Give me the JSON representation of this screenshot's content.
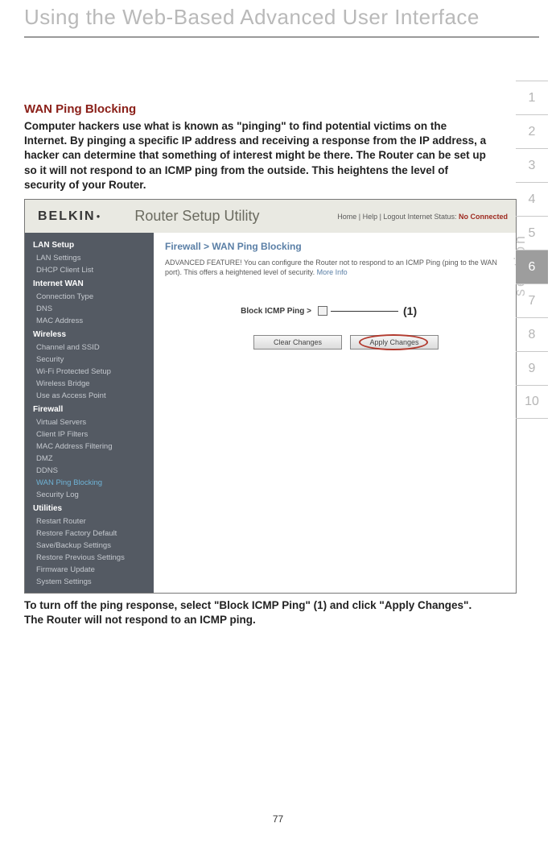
{
  "chapter_title": "Using the Web-Based Advanced User Interface",
  "heading": "WAN Ping Blocking",
  "paragraph1": "Computer hackers use what is known as \"pinging\" to find potential victims on the Internet. By pinging a specific IP address and receiving a response from the IP address, a hacker can determine that something of interest might be there. The Router can be set up so it will not respond to an ICMP ping from the outside. This heightens the level of security of your Router.",
  "paragraph2_a": "To turn off the ping response, select \"Block ICMP Ping\" ",
  "paragraph2_marker": "(1)",
  "paragraph2_b": " and click \"Apply Changes\". The Router will not respond to an ICMP ping.",
  "page_number": "77",
  "section_label": "section",
  "tabs": [
    "1",
    "2",
    "3",
    "4",
    "5",
    "6",
    "7",
    "8",
    "9",
    "10"
  ],
  "active_tab_index": 5,
  "screenshot": {
    "logo_text": "BELKIN",
    "utility_title": "Router Setup Utility",
    "top_links": "Home  |  Help |  Logout    Internet  Status: ",
    "top_status": "No Connected",
    "breadcrumb": "Firewall > WAN Ping Blocking",
    "adv_text_a": "ADVANCED FEATURE! You can configure the Router not to respond to an ICMP Ping (ping to the WAN port). This offers a heightened level of security. ",
    "adv_text_more": "More Info",
    "control_label": "Block ICMP Ping >",
    "callout": "(1)",
    "buttons": {
      "clear": "Clear Changes",
      "apply": "Apply Changes"
    },
    "sidebar": [
      {
        "type": "grp",
        "label": "LAN Setup"
      },
      {
        "type": "item",
        "label": "LAN Settings"
      },
      {
        "type": "item",
        "label": "DHCP Client List"
      },
      {
        "type": "grp",
        "label": "Internet WAN"
      },
      {
        "type": "item",
        "label": "Connection Type"
      },
      {
        "type": "item",
        "label": "DNS"
      },
      {
        "type": "item",
        "label": "MAC Address"
      },
      {
        "type": "grp",
        "label": "Wireless"
      },
      {
        "type": "item",
        "label": "Channel and SSID"
      },
      {
        "type": "item",
        "label": "Security"
      },
      {
        "type": "item",
        "label": "Wi-Fi Protected Setup"
      },
      {
        "type": "item",
        "label": "Wireless Bridge"
      },
      {
        "type": "item",
        "label": "Use as Access Point"
      },
      {
        "type": "grp",
        "label": "Firewall"
      },
      {
        "type": "item",
        "label": "Virtual Servers"
      },
      {
        "type": "item",
        "label": "Client IP Filters"
      },
      {
        "type": "item",
        "label": "MAC Address Filtering"
      },
      {
        "type": "item",
        "label": "DMZ"
      },
      {
        "type": "item",
        "label": "DDNS"
      },
      {
        "type": "item",
        "label": "WAN Ping Blocking",
        "active": true
      },
      {
        "type": "item",
        "label": "Security Log"
      },
      {
        "type": "grp",
        "label": "Utilities"
      },
      {
        "type": "item",
        "label": "Restart Router"
      },
      {
        "type": "item",
        "label": "Restore Factory Default"
      },
      {
        "type": "item",
        "label": "Save/Backup Settings"
      },
      {
        "type": "item",
        "label": "Restore Previous Settings"
      },
      {
        "type": "item",
        "label": "Firmware Update"
      },
      {
        "type": "item",
        "label": "System Settings"
      }
    ]
  }
}
